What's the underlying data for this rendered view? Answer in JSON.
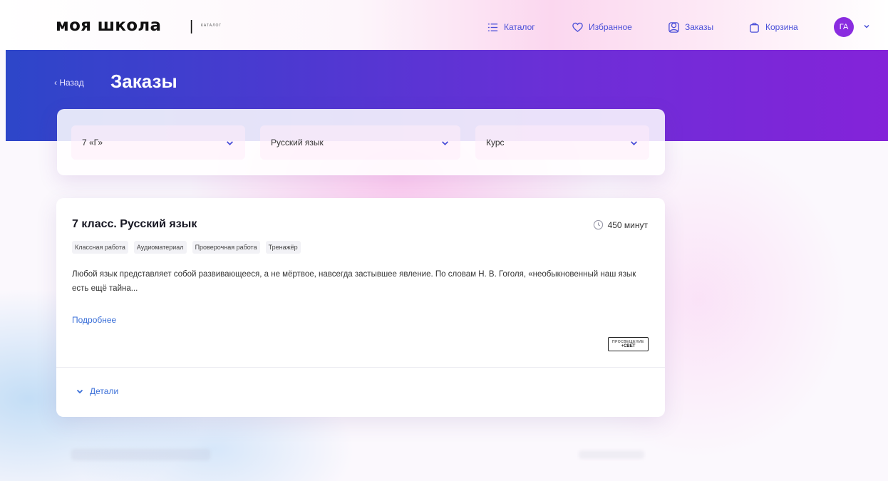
{
  "header": {
    "logo_text": "моя школа",
    "logo_separator": "|",
    "logo_subtitle": "каталог",
    "nav": [
      {
        "label": "Каталог",
        "icon": "list-icon"
      },
      {
        "label": "Избранное",
        "icon": "heart-icon"
      },
      {
        "label": "Заказы",
        "icon": "orders-icon"
      },
      {
        "label": "Корзина",
        "icon": "bag-icon"
      }
    ],
    "avatar_initials": "ГА"
  },
  "page": {
    "back_label": "‹ Назад",
    "title": "Заказы"
  },
  "filters": {
    "class_value": "7 «Г»",
    "subject_value": "Русский язык",
    "course_value": "Курс"
  },
  "card": {
    "title": "7 класс. Русский язык",
    "duration": "450 минут",
    "tags": [
      "Классная работа",
      "Аудиоматериал",
      "Проверочная работа",
      "Тренажёр"
    ],
    "description": "Любой язык представляет собой развивающееся, а не мёртвое, навсегда застывшее явление. По словам Н. В. Гоголя, «необыкновенный наш язык есть ещё тайна...",
    "more_label": "Подробнее",
    "publisher_line1": "ПРОСВЕЩЕНИЕ",
    "publisher_line2": "+СВЕТ",
    "details_label": "Детали"
  },
  "colors": {
    "accent_blue": "#3a6fd8",
    "banner_start": "#2d46c9",
    "banner_end": "#8423d9",
    "avatar": "#8a2ce0"
  }
}
